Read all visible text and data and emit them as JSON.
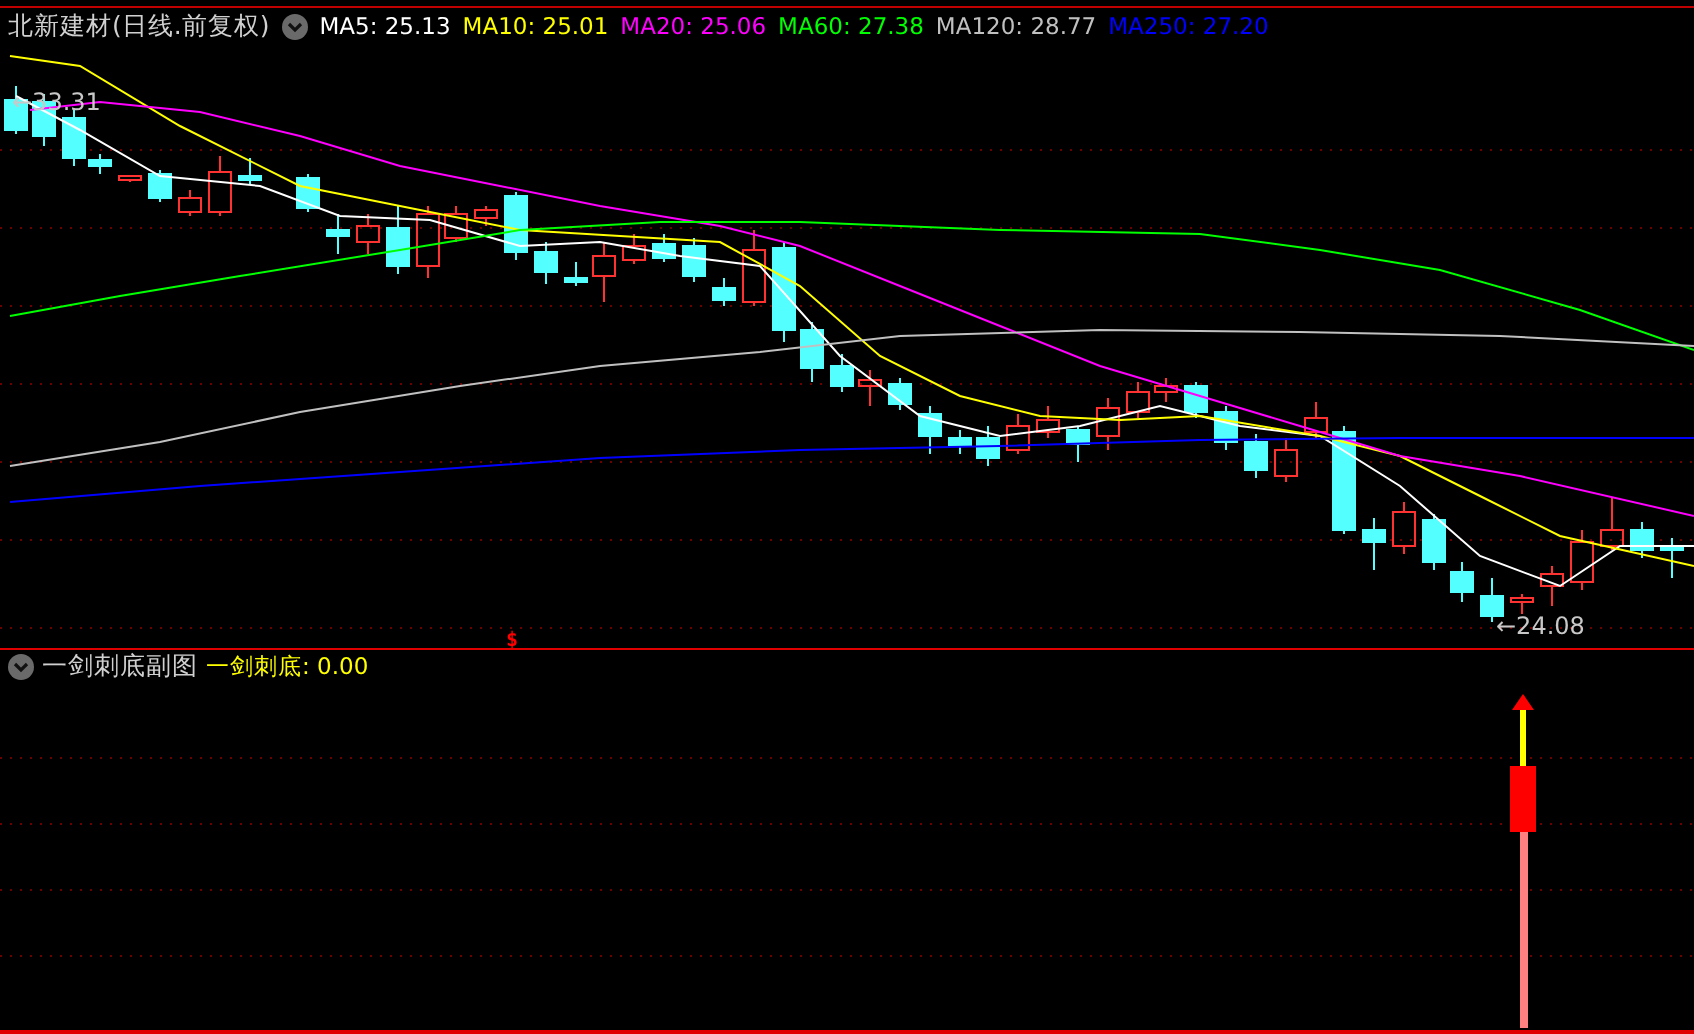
{
  "main_chart": {
    "title": "北新建材(日线.前复权)",
    "indicators": [
      {
        "label": "MA5: 25.13",
        "color": "#ffffff"
      },
      {
        "label": "MA10: 25.01",
        "color": "#ffff00"
      },
      {
        "label": "MA20: 25.06",
        "color": "#ff00ff"
      },
      {
        "label": "MA60: 27.38",
        "color": "#00ff00"
      },
      {
        "label": "MA120: 28.77",
        "color": "#c0c0c0"
      },
      {
        "label": "MA250: 27.20",
        "color": "#0000ff"
      }
    ],
    "high_label": "←33.31",
    "low_label": "←24.08",
    "marker": "$"
  },
  "sub_chart": {
    "title": "一剑刺底副图",
    "indicator": {
      "label": "一剑刺底: 0.00",
      "color": "#ffff00"
    }
  }
}
